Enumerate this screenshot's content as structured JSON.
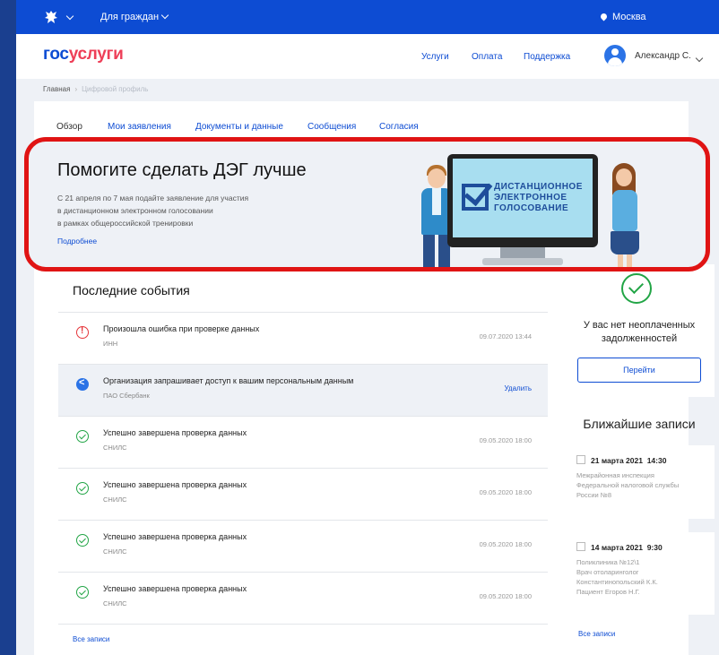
{
  "topbar": {
    "citizens_label": "Для граждан",
    "city": "Москва"
  },
  "header": {
    "logo_part1": "гос",
    "logo_part2": "услуги",
    "nav": [
      "Услуги",
      "Оплата",
      "Поддержка"
    ],
    "user_name": "Александр С."
  },
  "breadcrumb": {
    "home": "Главная",
    "separator": "›",
    "current": "Цифровой профиль"
  },
  "tabs": [
    "Обзор",
    "Мои заявления",
    "Документы и данные",
    "Сообщения",
    "Согласия"
  ],
  "banner": {
    "title": "Помогите сделать ДЭГ лучше",
    "text_lines": [
      "С 21 апреля по 7 мая подайте заявление для участия",
      "в дистанционном электронном голосовании",
      "в рамках общероссийской тренировки"
    ],
    "more_link": "Подробнее",
    "screen_lines": [
      "ДИСТАНЦИОННОЕ",
      "ЭЛЕКТРОННОЕ",
      "ГОЛОСОВАНИЕ"
    ]
  },
  "events": {
    "title": "Последние события",
    "items": [
      {
        "icon": "error-icon",
        "title": "Произошла ошибка при проверке данных",
        "sub": "ИНН",
        "date": "09.07.2020 13:44",
        "link": ""
      },
      {
        "icon": "share-icon",
        "title": "Организация запрашивает доступ к вашим персональным данным",
        "sub": "ПАО Сбербанк",
        "date": "",
        "link": "Удалить"
      },
      {
        "icon": "check-icon",
        "title": "Успешно завершена проверка данных",
        "sub": "СНИЛС",
        "date": "09.05.2020 18:00",
        "link": ""
      },
      {
        "icon": "check-icon",
        "title": "Успешно завершена проверка данных",
        "sub": "СНИЛС",
        "date": "09.05.2020 18:00",
        "link": ""
      },
      {
        "icon": "check-icon",
        "title": "Успешно завершена проверка данных",
        "sub": "СНИЛС",
        "date": "09.05.2020 18:00",
        "link": ""
      },
      {
        "icon": "check-icon",
        "title": "Успешно завершена проверка данных",
        "sub": "СНИЛС",
        "date": "09.05.2020 18:00",
        "link": ""
      }
    ],
    "all_link": "Все записи"
  },
  "debt": {
    "line1": "У вас нет неоплаченных",
    "line2": "задолженностей",
    "button": "Перейти"
  },
  "appointments": {
    "title": "Ближайшие записи",
    "items": [
      {
        "date": "21 марта 2021",
        "time": "14:30",
        "lines": [
          "Межрайонная инспекция",
          "Федеральной налоговой службы",
          "России №8"
        ]
      },
      {
        "date": "14 марта 2021",
        "time": "9:30",
        "lines": [
          "Поликлиника №12\\1",
          "Врач отоларинголог",
          "Константинопольский К.К.",
          "Пациент Егоров Н.Г."
        ]
      }
    ],
    "all_link": "Все записи"
  },
  "colors": {
    "brand_blue": "#0d4cd3",
    "brand_red": "#ee3f58",
    "highlight_frame": "#e01414",
    "success": "#22a546",
    "error": "#e5363b"
  }
}
